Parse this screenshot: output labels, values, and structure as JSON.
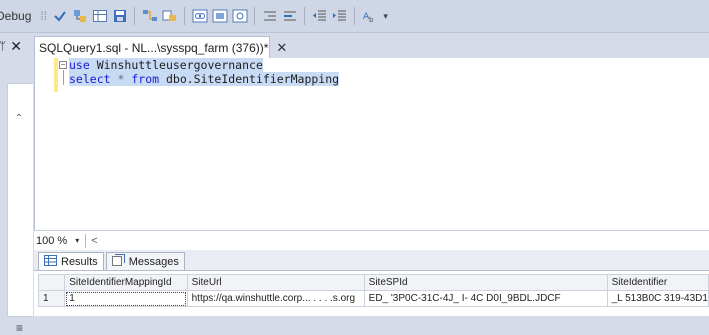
{
  "toolbar": {
    "debug_label": "Debug",
    "icons": [
      "grip-icon",
      "checkmark-icon",
      "query-designer-icon",
      "results-to-grid-icon",
      "results-to-file-icon",
      "display-plan-icon",
      "include-stats-icon",
      "comment-icon",
      "uncomment-icon",
      "decrease-indent-icon",
      "increase-indent-icon",
      "specify-values-icon"
    ]
  },
  "left_panel": {
    "pin": "ᛘ",
    "close": "✕"
  },
  "document_tab": {
    "title": "SQLQuery1.sql - NL...\\sysspq_farm (376))*",
    "close": "✕"
  },
  "editor": {
    "line1_keyword": "use",
    "line1_text": " Winshuttleusergovernance",
    "line2_keyword1": "select",
    "line2_star": " *",
    "line2_keyword2": "from",
    "line2_text": " dbo.SiteIdentifierMapping"
  },
  "zoom": {
    "value": "100 %",
    "dropdown": "▾",
    "scroll_left": "<"
  },
  "result_tabs": {
    "results_label": "Results",
    "messages_label": "Messages"
  },
  "grid": {
    "columns": [
      "SiteIdentifierMappingId",
      "SiteUrl",
      "SiteSPId",
      "SiteIdentifier"
    ],
    "rows": [
      {
        "num": "1",
        "cells": [
          "1",
          "https://qa.winshuttle.corp... . . . .s.org",
          "ED_ '3P0C-31C-4J_ I- 4C  D0I_9BDL.JDCF",
          "_L 513B0C 319-43D1"
        ]
      }
    ]
  },
  "colors": {
    "keyword": "#1a1ad6",
    "selection": "#c8dbf5",
    "toolbar_bg": "#cfd6e5"
  }
}
